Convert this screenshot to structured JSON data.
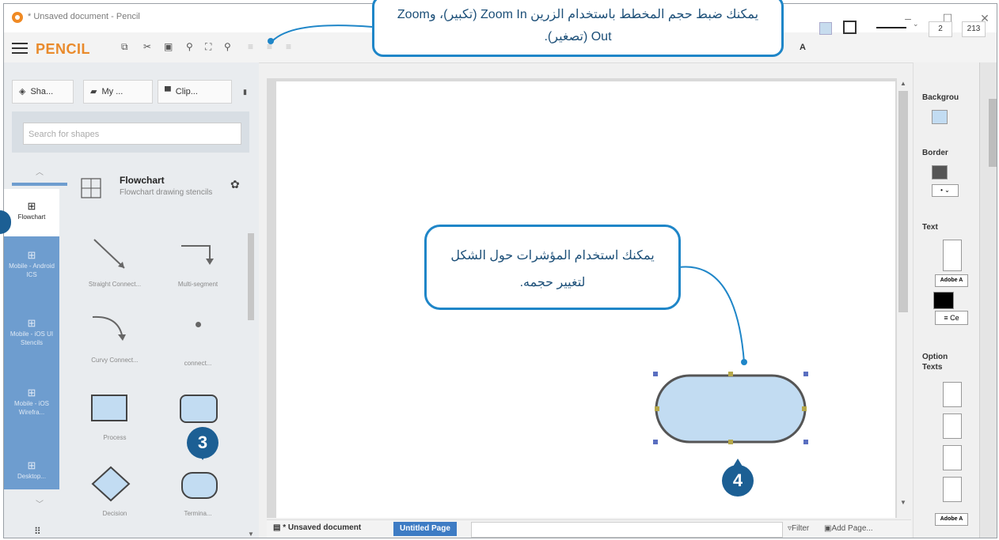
{
  "window": {
    "title": "* Unsaved document - Pencil",
    "minimize": "–",
    "maximize": "☐",
    "close": "✕"
  },
  "toolbar": {
    "brand": "PENCIL",
    "line_width": "2",
    "zoom_value": "213"
  },
  "tabs": [
    {
      "label": "Sha...",
      "icon": "layers-icon"
    },
    {
      "label": "My ...",
      "icon": "briefcase-icon"
    },
    {
      "label": "Clip...",
      "icon": "image-icon"
    }
  ],
  "search": {
    "placeholder": "Search for shapes"
  },
  "collections": [
    {
      "label": "Flowchart",
      "selected": true
    },
    {
      "label": "Mobile - Android ICS"
    },
    {
      "label": "Mobile - iOS UI Stencils"
    },
    {
      "label": "Mobile - iOS Wirefra..."
    },
    {
      "label": "Desktop..."
    }
  ],
  "stencil": {
    "title": "Flowchart",
    "description": "Flowchart drawing stencils"
  },
  "shapes": [
    {
      "label": "Straight Connect..."
    },
    {
      "label": "Multi-segment"
    },
    {
      "label": "Curvy Connect..."
    },
    {
      "label": "connect..."
    },
    {
      "label": "Process"
    },
    {
      "label": ""
    },
    {
      "label": "Decision"
    },
    {
      "label": "Termina..."
    }
  ],
  "bottom": {
    "doc_tab": "* Unsaved document",
    "page_tab": "Untitled Page",
    "filter": "Filter",
    "add_page": "Add Page..."
  },
  "properties": {
    "background": "Backgrou",
    "border": "Border",
    "text": "Text",
    "font_a": "Adobe A",
    "align": "Ce",
    "option_texts": "Option Texts",
    "font_b": "Adobe A"
  },
  "callouts": {
    "top": "يمكنك ضبط حجم المخطط باستخدام الزرين Zoom In (تكبير)، وZoom Out (تصغير).",
    "middle": "يمكنك استخدام المؤشرات حول الشكل لتغيير حجمه."
  },
  "badges": {
    "step3": "3",
    "step4": "4"
  },
  "colors": {
    "accent": "#1f86c8",
    "badge": "#1c5f94",
    "shape_fill": "#c2dcf2",
    "brand": "#e98a2b"
  }
}
